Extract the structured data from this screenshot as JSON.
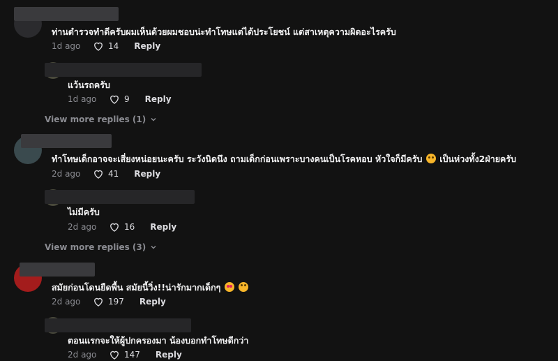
{
  "comments": [
    {
      "text": "ท่านตำรวจทำดีครับผมเห็นด้วยผมชอบน่ะทำโทษแต่ได้ประโยชน์ แต่สาเหตุความผิดอะไรครับ",
      "time": "1d ago",
      "likes": "14",
      "reply_label": "Reply",
      "reply": {
        "text": "แว้นรถครับ",
        "time": "1d ago",
        "likes": "9",
        "reply_label": "Reply"
      },
      "view_more": "View more replies (1)"
    },
    {
      "text": "ทำโทษเด็กอาจจะเสี่ยงหน่อยนะครับ ระวังนิดนึง ถามเด็กก่อนเพราะบางคนเป็นโรคหอบ หัวใจก็มีครับ",
      "text_tail": "เป็นห่วงทั้ง2ฝ่ายครับ",
      "time": "2d ago",
      "likes": "41",
      "reply_label": "Reply",
      "reply": {
        "text": "ไม่มีครับ",
        "time": "2d ago",
        "likes": "16",
        "reply_label": "Reply"
      },
      "view_more": "View more replies (3)"
    },
    {
      "text": "สมัยก่อนโดนยืดพื้น สมัยนี้วิ่ง!!น่ารักมากเด็กๆ",
      "time": "2d ago",
      "likes": "197",
      "reply_label": "Reply",
      "reply": {
        "text": "ตอนแรกจะให้ผู้ปกครองมา น้องบอกทำโทษดีกว่า",
        "time": "2d ago",
        "likes": "147",
        "reply_label": "Reply"
      }
    }
  ],
  "icons": {
    "like": "heart-outline-icon",
    "expand": "chevron-down-icon"
  },
  "colors": {
    "background": "#121212",
    "text": "#f1f1f2",
    "muted": "#8a8b91"
  }
}
